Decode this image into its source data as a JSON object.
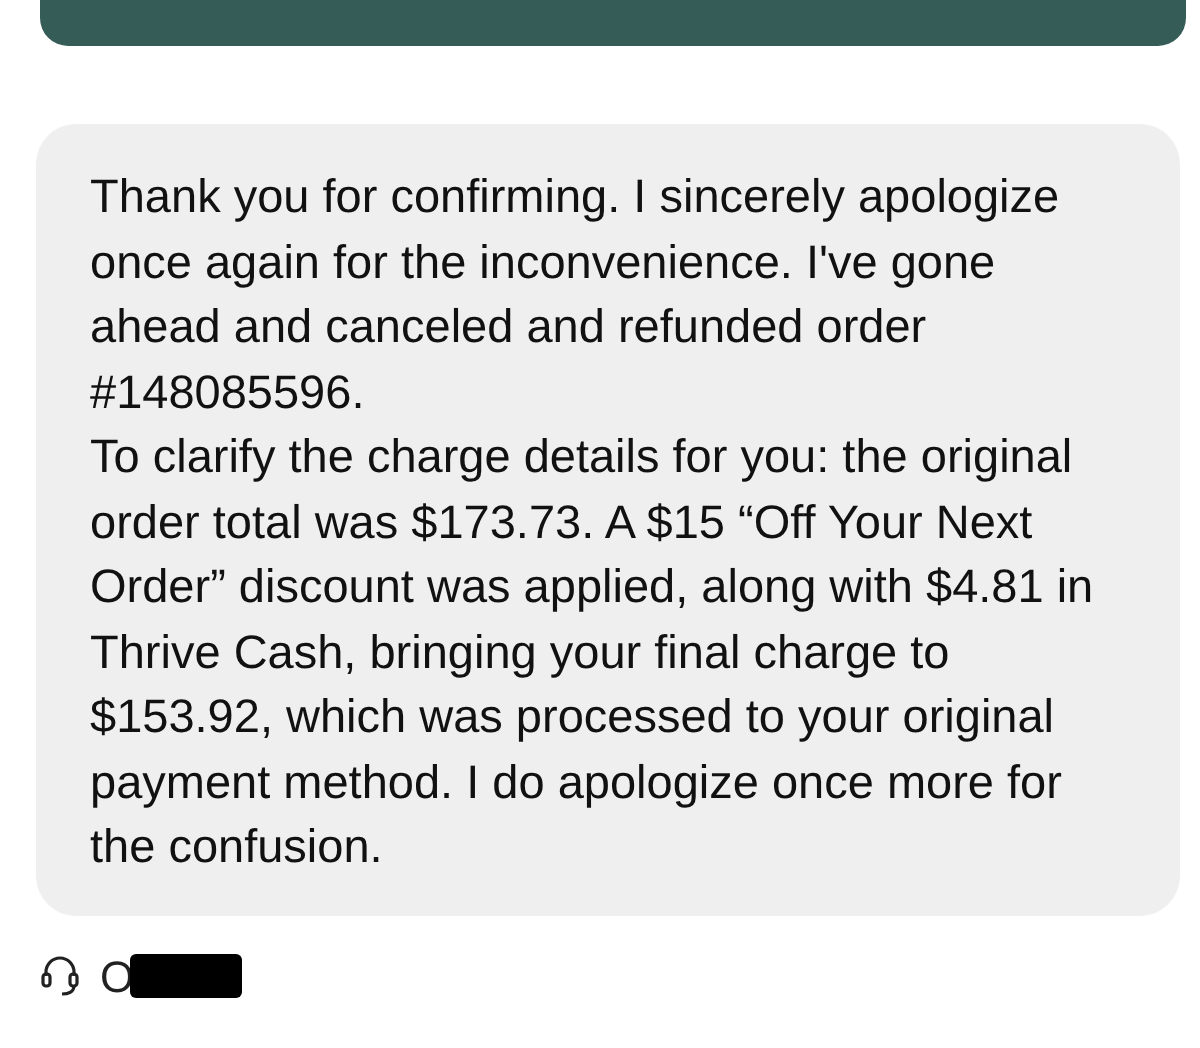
{
  "sent_message": {
    "kind": "outgoing"
  },
  "received_message": {
    "kind": "incoming",
    "paragraphs": [
      "Thank you for confirming. I sincerely apologize once again for the inconvenience. I've gone ahead and canceled and refunded order #148085596.",
      "To clarify the charge details for you: the original order total was $173.73. A $15 “Off Your Next Order” discount was applied, along with $4.81 in Thrive Cash, bringing your final charge to $153.92, which was processed to your original payment method. I do apologize once more for the confusion."
    ]
  },
  "sender": {
    "name": "O",
    "redacted": true
  }
}
